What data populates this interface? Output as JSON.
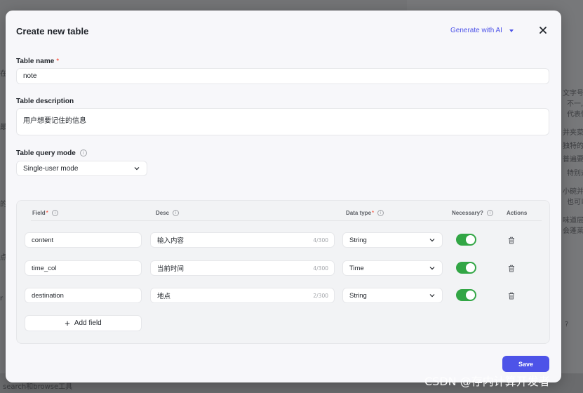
{
  "background": {
    "right_texts": [
      "文字号,",
      "不一,",
      "代表性",
      "并夹菜品",
      "独特的味",
      "普遍要求",
      "特别适",
      "小碗并",
      "也可以",
      "味道层",
      "会蓬莱春"
    ],
    "left_texts": [
      "在",
      "最",
      "的",
      "点",
      "r"
    ],
    "bottom_text": "search和browse工具",
    "chat_hint": "?"
  },
  "modal": {
    "title": "Create new table",
    "generate_ai_label": "Generate with AI",
    "table_name_label": "Table name",
    "required_mark": "*",
    "table_name_value": "note",
    "table_description_label": "Table description",
    "table_description_value": "用户想要记住的信息",
    "query_mode_label": "Table query mode",
    "query_mode_value": "Single-user mode",
    "save_label": "Save"
  },
  "fields_table": {
    "headers": {
      "field": "Field",
      "desc": "Desc",
      "data_type": "Data type",
      "necessary": "Necessary?",
      "actions": "Actions"
    },
    "rows": [
      {
        "field": "content",
        "desc": "输入内容",
        "counter": "4/300",
        "data_type": "String",
        "necessary": true
      },
      {
        "field": "time_col",
        "desc": "当前时间",
        "counter": "4/300",
        "data_type": "Time",
        "necessary": true
      },
      {
        "field": "destination",
        "desc": "地点",
        "counter": "2/300",
        "data_type": "String",
        "necessary": true
      }
    ],
    "add_field_label": "Add field"
  },
  "watermark": "CSDN @存内计算开发者",
  "colors": {
    "accent": "#4d53e8",
    "toggle_on": "#32a645",
    "required": "#f93920"
  }
}
